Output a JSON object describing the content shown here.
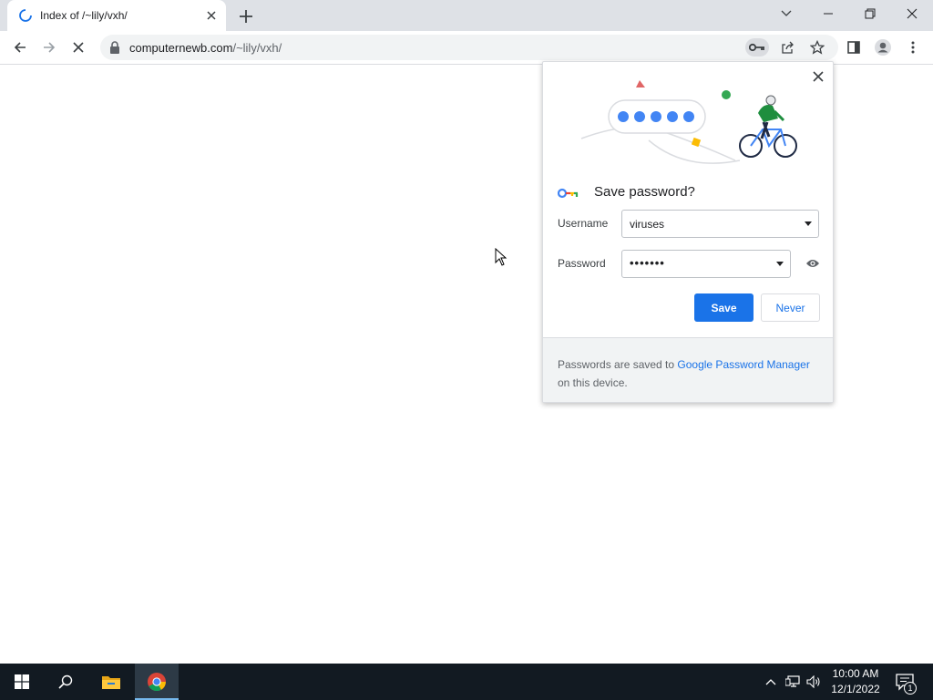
{
  "tab": {
    "title": "Index of /~lily/vxh/"
  },
  "omnibox": {
    "host": "computernewb.com",
    "path": "/~lily/vxh/"
  },
  "password_popup": {
    "title": "Save password?",
    "username_label": "Username",
    "username_value": "viruses",
    "password_label": "Password",
    "password_masked": "•••••••",
    "save_label": "Save",
    "never_label": "Never",
    "footer_before": "Passwords are saved to ",
    "footer_link": "Google Password Manager",
    "footer_after": " on this device."
  },
  "taskbar": {
    "time": "10:00 AM",
    "date": "12/1/2022",
    "notification_count": "1"
  },
  "colors": {
    "accent": "#1a73e8",
    "tabstrip": "#dee1e6",
    "taskbar": "#121a22"
  },
  "icons": [
    "loading-spinner-icon",
    "close-icon",
    "plus-icon",
    "chevron-down-icon",
    "minimize-icon",
    "restore-icon",
    "back-arrow-icon",
    "forward-arrow-icon",
    "stop-icon",
    "lock-icon",
    "key-icon",
    "share-icon",
    "star-icon",
    "sidebar-icon",
    "profile-icon",
    "more-vert-icon",
    "eye-icon",
    "windows-start-icon",
    "search-icon",
    "file-explorer-icon",
    "chrome-icon",
    "chevron-up-icon",
    "network-icon",
    "volume-icon",
    "notification-icon"
  ]
}
